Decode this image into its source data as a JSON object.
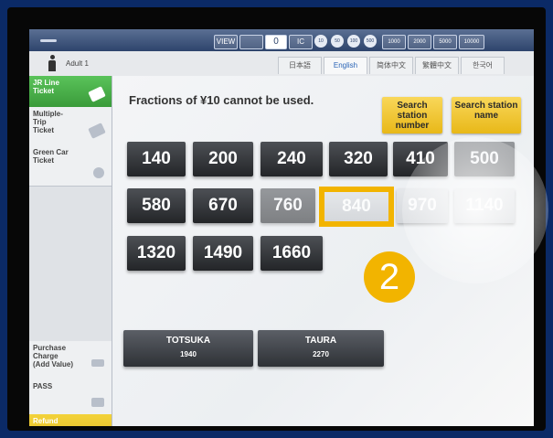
{
  "topbar": {
    "labels": [
      "VIEW",
      "",
      "0",
      "IC"
    ],
    "circles": [
      "10",
      "50",
      "100",
      "500",
      "1000",
      "2000",
      "5000",
      "10000"
    ]
  },
  "passenger": {
    "label": "Adult  1"
  },
  "languages": [
    {
      "label": "日本語",
      "active": false
    },
    {
      "label": "English",
      "active": true
    },
    {
      "label": "简体中文",
      "active": false
    },
    {
      "label": "繁體中文",
      "active": false
    },
    {
      "label": "한국어",
      "active": false
    }
  ],
  "sidebar": {
    "items": [
      {
        "label": "JR Line\nTicket"
      },
      {
        "label": "Multiple-\nTrip\nTicket"
      },
      {
        "label": "Green Car\nTicket"
      },
      {
        "label": "Purchase\nCharge\n(Add Value)"
      },
      {
        "label": "PASS"
      },
      {
        "label": "Refund"
      }
    ]
  },
  "main": {
    "notice": "Fractions of ¥10 cannot be used.",
    "search_number": "Search station number",
    "search_name": "Search station name"
  },
  "fares": [
    "140",
    "200",
    "240",
    "320",
    "410",
    "500",
    "580",
    "670",
    "760",
    "840",
    "970",
    "1140",
    "1320",
    "1490",
    "1660"
  ],
  "destinations": [
    {
      "name": "TOTSUKA",
      "price": "1940"
    },
    {
      "name": "TAURA",
      "price": "2270"
    }
  ],
  "marker": {
    "label": "2"
  },
  "colors": {
    "accent": "#f2b400",
    "active_tab": "#3a9b3a",
    "button_dark": "#2e3136"
  }
}
